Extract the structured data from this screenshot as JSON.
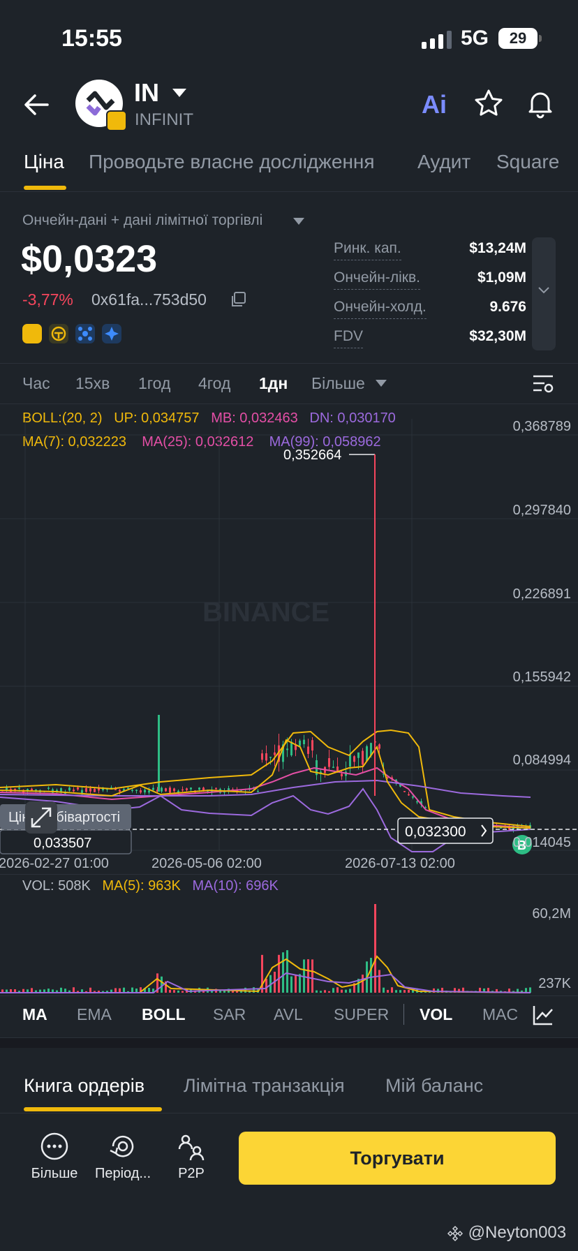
{
  "status_bar": {
    "time": "15:55",
    "network": "5G",
    "battery": "29"
  },
  "header": {
    "symbol": "IN",
    "name": "INFINIT"
  },
  "tabs": [
    {
      "label": "Ціна"
    },
    {
      "label": "Проводьте власне дослідження"
    },
    {
      "label": "Аудит"
    },
    {
      "label": "Square"
    }
  ],
  "summary": {
    "data_source": "Ончейн-дані + дані лімітної торгівлі",
    "price": "$0,0323",
    "change": "-3,77%",
    "address": "0x61fa...753d50",
    "stats": [
      {
        "label": "Ринк. кап.",
        "value": "$13,24M"
      },
      {
        "label": "Ончейн-лікв.",
        "value": "$1,09M"
      },
      {
        "label": "Ончейн-холд.",
        "value": "9.676"
      },
      {
        "label": "FDV",
        "value": "$32,30M"
      }
    ]
  },
  "timeframes": [
    "Час",
    "15хв",
    "1год",
    "4год",
    "1дн",
    "Більше"
  ],
  "active_timeframe": "1дн",
  "indicators": {
    "boll": {
      "label": "BOLL:(20, 2)",
      "up": "UP: 0,034757",
      "mb": "MB: 0,032463",
      "dn": "DN: 0,030170"
    },
    "ma": {
      "ma7": "MA(7): 0,032223",
      "ma25": "MA(25): 0,032612",
      "ma99": "MA(99): 0,058962"
    },
    "vol": {
      "vol": "VOL: 508K",
      "ma5": "MA(5): 963K",
      "ma10": "MA(10): 696K"
    }
  },
  "chart_labels": {
    "high_marker": "0,352664",
    "current_price": "0,032300",
    "cost_label": "Ціна собівартості",
    "cost_value": "0,033507",
    "y_ticks": [
      "0,368789",
      "0,297840",
      "0,226891",
      "0,155942",
      "0,084994",
      "0,014045"
    ],
    "x_ticks": [
      "2026-02-27 01:00",
      "2026-05-06 02:00",
      "2026-07-13 02:00"
    ],
    "vol_ticks": [
      "60,2M",
      "237K"
    ],
    "buy_marker": "B",
    "watermark": "BINANCE"
  },
  "chart_data": {
    "type": "candlestick",
    "y_axis_range": [
      0.014045,
      0.368789
    ],
    "high_point": 0.352664,
    "last_price": 0.0323
  },
  "indicator_tabs": [
    "MA",
    "EMA",
    "BOLL",
    "SAR",
    "AVL",
    "SUPER",
    "VOL",
    "MAC"
  ],
  "bottom_tabs": [
    "Книга ордерів",
    "Лімітна транзакція",
    "Мій баланс"
  ],
  "actions": [
    "Більше",
    "Період...",
    "P2P"
  ],
  "trade_button": "Торгувати",
  "credit": "@Neyton003",
  "colors": {
    "accent": "#f0b90b",
    "up": "#2ebd85",
    "down": "#f6465d",
    "ma7": "#f0b90b",
    "ma25": "#e44fa6",
    "ma99": "#9c6ade"
  }
}
